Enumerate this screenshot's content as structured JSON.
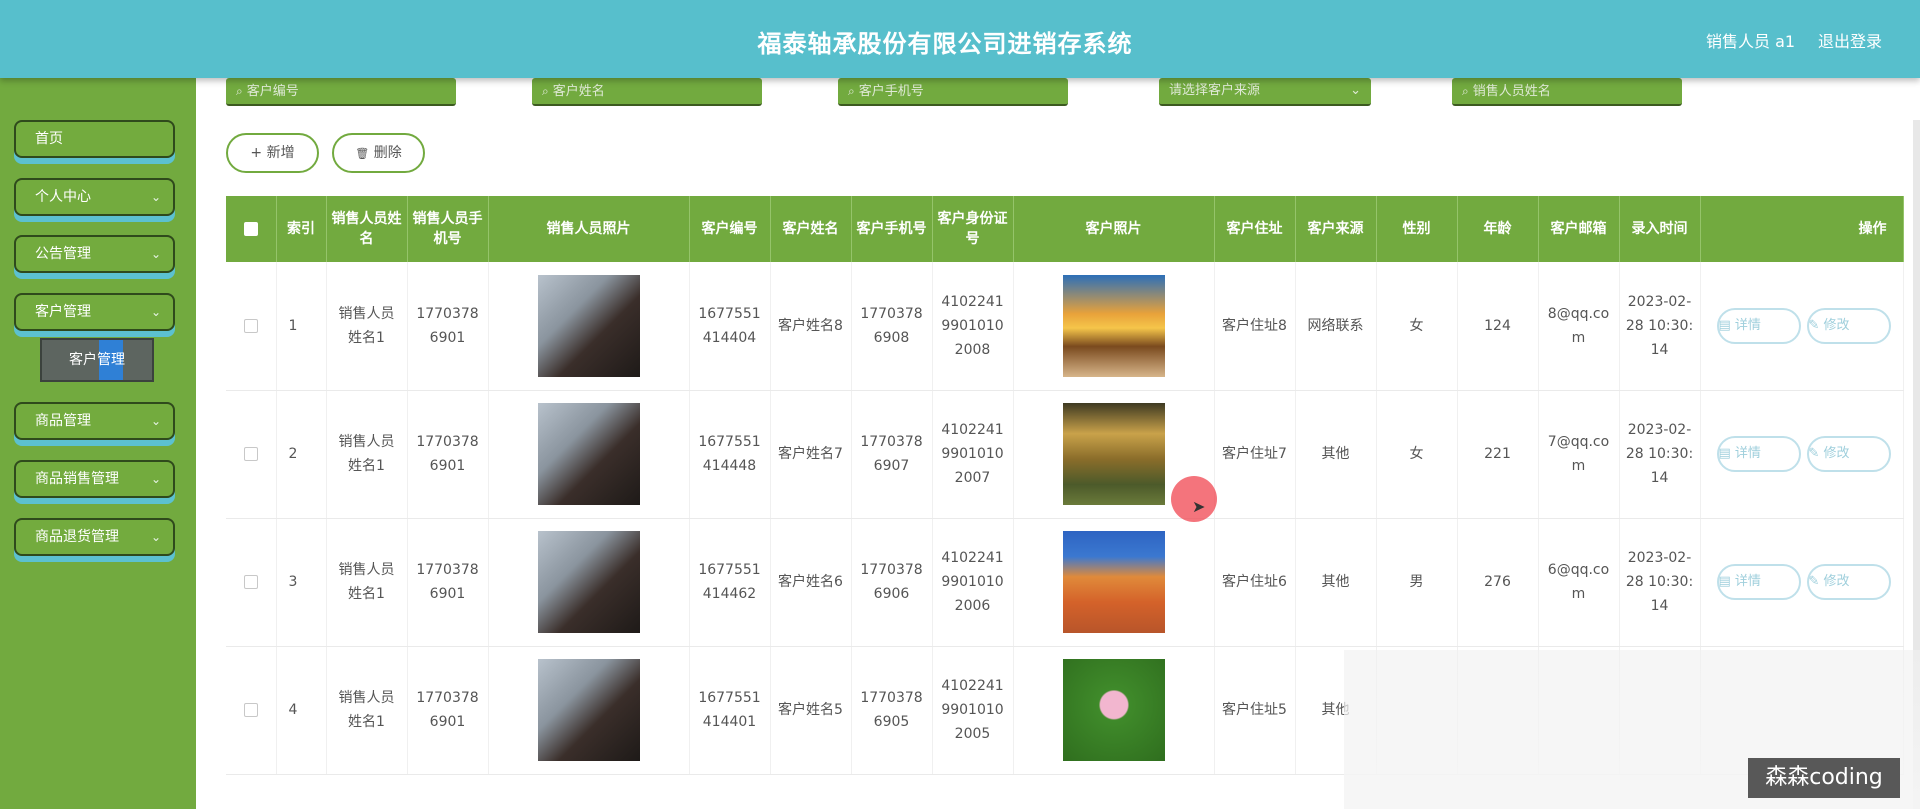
{
  "header": {
    "title": "福泰轴承股份有限公司进销存系统",
    "user": "销售人员 a1",
    "logout": "退出登录"
  },
  "sidebar": {
    "items": [
      {
        "label": "首页",
        "has_chevron": false
      },
      {
        "label": "个人中心",
        "has_chevron": true
      },
      {
        "label": "公告管理",
        "has_chevron": true
      },
      {
        "label": "客户管理",
        "has_chevron": true
      },
      {
        "label": "商品管理",
        "has_chevron": true
      },
      {
        "label": "商品销售管理",
        "has_chevron": true
      },
      {
        "label": "商品退货管理",
        "has_chevron": true
      }
    ],
    "active_sub": "客户管理",
    "chevron": "⌄"
  },
  "search": {
    "customer_no": "客户编号",
    "customer_name": "客户姓名",
    "customer_phone": "客户手机号",
    "customer_source": "请选择客户来源",
    "seller_name": "销售人员姓名",
    "search_icon": "search-icon",
    "dropdown_icon": "chevron-down-icon"
  },
  "toolbar": {
    "add": "新增",
    "delete": "删除",
    "add_icon": "+",
    "delete_icon": "🗑"
  },
  "table": {
    "headers": [
      "索引",
      "销售人员姓名",
      "销售人员手机号",
      "销售人员照片",
      "客户编号",
      "客户姓名",
      "客户手机号",
      "客户身份证号",
      "客户照片",
      "客户住址",
      "客户来源",
      "性别",
      "年龄",
      "客户邮箱",
      "录入时间",
      "操作"
    ],
    "rows": [
      {
        "index": "1",
        "seller_name": "销售人员姓名1",
        "seller_phone": "17703786901",
        "customer_no": "1677551414404",
        "customer_name": "客户姓名8",
        "customer_phone": "17703786908",
        "id_no": "410224199010102008",
        "address": "客户住址8",
        "source": "网络联系",
        "gender": "女",
        "age": "124",
        "email": "8@qq.com",
        "time": "2023-02-28 10:30:14",
        "photo_color": "sunset"
      },
      {
        "index": "2",
        "seller_name": "销售人员姓名1",
        "seller_phone": "17703786901",
        "customer_no": "1677551414448",
        "customer_name": "客户姓名7",
        "customer_phone": "17703786907",
        "id_no": "410224199010102007",
        "address": "客户住址7",
        "source": "其他",
        "gender": "女",
        "age": "221",
        "email": "7@qq.com",
        "time": "2023-02-28 10:30:14",
        "photo_color": "mountain"
      },
      {
        "index": "3",
        "seller_name": "销售人员姓名1",
        "seller_phone": "17703786901",
        "customer_no": "1677551414462",
        "customer_name": "客户姓名6",
        "customer_phone": "17703786906",
        "id_no": "410224199010102006",
        "address": "客户住址6",
        "source": "其他",
        "gender": "男",
        "age": "276",
        "email": "6@qq.com",
        "time": "2023-02-28 10:30:14",
        "photo_color": "desert"
      },
      {
        "index": "4",
        "seller_name": "销售人员姓名1",
        "seller_phone": "17703786901",
        "customer_no": "1677551414401",
        "customer_name": "客户姓名5",
        "customer_phone": "17703786905",
        "id_no": "410224199010102005",
        "address": "客户住址5",
        "source": "其他",
        "gender": "",
        "age": "",
        "email": "",
        "time": "",
        "photo_color": "lotus"
      }
    ],
    "actions": {
      "detail": "详情",
      "edit": "修改"
    }
  },
  "watermark": "森森coding"
}
